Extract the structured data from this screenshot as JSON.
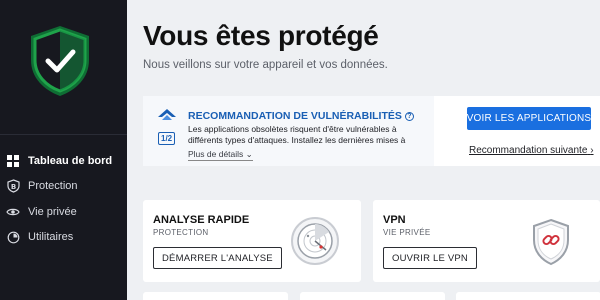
{
  "sidebar": {
    "logo_icon": "shield-check-icon",
    "items": [
      {
        "label": "Tableau de bord",
        "icon": "dashboard-icon",
        "active": true
      },
      {
        "label": "Protection",
        "icon": "protection-b-icon",
        "active": false
      },
      {
        "label": "Vie privée",
        "icon": "eye-icon",
        "active": false
      },
      {
        "label": "Utilitaires",
        "icon": "utilities-icon",
        "active": false
      }
    ]
  },
  "header": {
    "title": "Vous êtes protégé",
    "subtitle": "Nous veillons sur votre appareil et vos données."
  },
  "recommendation": {
    "counter": "1/2",
    "title": "RECOMMANDATION DE VULNÉRABILITÉS",
    "text": "Les applications obsolètes risquent d'être vulnérables à différents types d'attaques. Installez les dernières mises à",
    "more": "Plus de détails",
    "primary_button": "VOIR LES APPLICATIONS",
    "next_link": "Recommandation suivante"
  },
  "cards": {
    "quick_scan": {
      "title": "ANALYSE RAPIDE",
      "subtitle": "PROTECTION",
      "button": "DÉMARRER L'ANALYSE",
      "icon": "radar-scan-icon"
    },
    "vpn": {
      "title": "VPN",
      "subtitle": "VIE PRIVÉE",
      "button": "OUVRIR LE VPN",
      "icon": "vpn-shield-icon"
    }
  },
  "colors": {
    "sidebar_bg": "#17181f",
    "accent_blue": "#1a6fe0",
    "shield_green": "#1fa34a"
  }
}
